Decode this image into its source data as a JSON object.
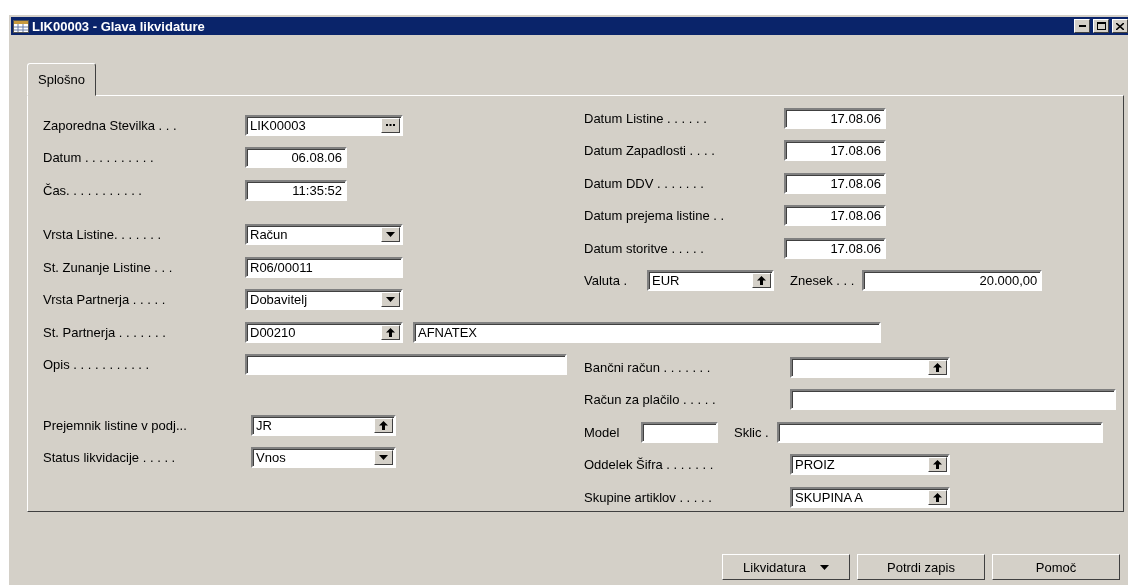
{
  "window": {
    "title": "LIK00003 - Glava likvidature"
  },
  "tabs": [
    {
      "label": "Splošno",
      "selected": true
    }
  ],
  "left_sections": [
    {
      "rows": [
        {
          "fields": [
            {
              "label": "Zaporedna Stevilka . . .",
              "kind": "assist",
              "value": "LIK00003"
            }
          ]
        },
        {
          "fields": [
            {
              "label": "Datum . . . . . . . . . .",
              "kind": "date",
              "value": "06.08.06"
            }
          ]
        },
        {
          "fields": [
            {
              "label": "Čas. . . . . . . . . . .",
              "kind": "date",
              "value": "11:35:52"
            }
          ]
        }
      ]
    },
    {
      "rows": [
        {
          "fields": [
            {
              "label": "Vrsta Listine. . . . . . .",
              "kind": "dropdown",
              "value": "Račun"
            }
          ]
        },
        {
          "fields": [
            {
              "label": "St.  Zunanje Listine . . .",
              "kind": "text",
              "value": "R06/00011"
            }
          ]
        },
        {
          "fields": [
            {
              "label": "Vrsta Partnerja . . . . .",
              "kind": "dropdown",
              "value": "Dobavitelj"
            }
          ]
        },
        {
          "fields": [
            {
              "label": "St. Partnerja . . . . . . .",
              "kind": "lookup",
              "value": "D00210"
            },
            {
              "kind": "text",
              "value": "AFNATEX"
            }
          ]
        },
        {
          "fields": [
            {
              "label": "Opis . . . . . . . . . . .",
              "kind": "text"
            }
          ]
        }
      ]
    },
    {
      "rows": [
        {
          "fields": [
            {
              "label": "Prejemnik listine v podj...",
              "kind": "lookup",
              "value": "JR"
            }
          ]
        },
        {
          "fields": [
            {
              "label": "Status likvidacije . . . . .",
              "kind": "dropdown",
              "value": "Vnos"
            }
          ]
        }
      ]
    }
  ],
  "right_sections": [
    {
      "rows": [
        {
          "fields": [
            {
              "label": "Datum Listine . . . . . .",
              "kind": "date",
              "value": "17.08.06"
            }
          ]
        },
        {
          "fields": [
            {
              "label": "Datum Zapadlosti . . . .",
              "kind": "date",
              "value": "17.08.06"
            }
          ]
        },
        {
          "fields": [
            {
              "label": "Datum DDV . . . . . . .",
              "kind": "date",
              "value": "17.08.06"
            }
          ]
        },
        {
          "fields": [
            {
              "label": "Datum prejema listine . .",
              "kind": "date",
              "value": "17.08.06"
            }
          ]
        },
        {
          "fields": [
            {
              "label": "Datum storitve . . . . .",
              "kind": "date",
              "value": "17.08.06"
            }
          ]
        },
        {
          "fields": [
            {
              "label": "Valuta .",
              "kind": "lookup",
              "value": "EUR"
            },
            {
              "label": "Znesek . . .",
              "kind": "number",
              "value": "20.000,00"
            }
          ]
        }
      ]
    },
    {
      "rows": [
        {
          "fields": [
            {
              "label": "Bančni račun . . . . . . .",
              "kind": "lookup"
            }
          ]
        },
        {
          "fields": [
            {
              "label": "Račun za plačilo . . . . .",
              "kind": "text"
            }
          ]
        },
        {
          "fields": [
            {
              "label": "Model",
              "kind": "text"
            },
            {
              "label": "Sklic .",
              "kind": "text"
            }
          ]
        },
        {
          "fields": [
            {
              "label": "Oddelek Šifra . . . . . . .",
              "kind": "lookup",
              "value": "PROIZ"
            }
          ]
        },
        {
          "fields": [
            {
              "label": "Skupine artiklov . . . . .",
              "kind": "lookup",
              "value": "SKUPINA A"
            }
          ]
        }
      ]
    }
  ],
  "buttons": [
    {
      "label": "Likvidatura",
      "kind": "menu"
    },
    {
      "label": "Potrdi zapis",
      "kind": "plain"
    },
    {
      "label": "Pomoč",
      "kind": "plain"
    }
  ]
}
